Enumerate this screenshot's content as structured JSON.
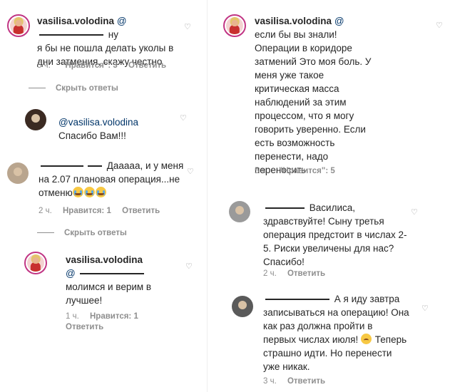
{
  "left": {
    "c1": {
      "username": "vasilisa.volodina",
      "mention": "@",
      "line1_tail": "ну",
      "line2": "я бы не пошла делать уколы в",
      "line3": "дни затмения, скажу честно",
      "time": "5 ч.",
      "likes": "\"Нравится\": 3",
      "reply": "Ответить"
    },
    "hide1": "Скрыть ответы",
    "c2": {
      "line1": "@vasilisa.volodina",
      "line2": "Спасибо Вам!!!"
    },
    "c3": {
      "line1": "Дааааа, и у меня",
      "line2": "на 2.07 плановая операция...не",
      "line3": "отменю",
      "time": "2 ч.",
      "likes": "Нравится: 1",
      "reply": "Ответить"
    },
    "hide2": "Скрыть ответы",
    "c4": {
      "username": "vasilisa.volodina",
      "mention": "@",
      "line2": "молимся и верим в",
      "line3": "лучшее!",
      "time": "1 ч.",
      "likes": "Нравится: 1",
      "reply": "Ответить"
    }
  },
  "right": {
    "c1": {
      "username": "vasilisa.volodina",
      "mention": "@",
      "lines": [
        "если бы вы знали!",
        "Операции в коридоре",
        "затмений Это моя боль. У",
        "меня уже такое",
        "критическая масса",
        "наблюдений за этим",
        "процессом, что я могу",
        "говорить уверенно. Если",
        "есть возможность",
        "перенести, надо",
        "переносить"
      ],
      "time": "5 ч.",
      "likes": "\"Нравится\": 5"
    },
    "c2": {
      "lines": [
        "Василиса,",
        "здравствуйте! Сыну третья",
        "операция предстоит в числах 2-",
        "5. Риски увеличены для нас?",
        "Спасибо!"
      ],
      "time": "2 ч.",
      "reply": "Ответить"
    },
    "c3": {
      "lines": [
        "А я иду завтра",
        "записываться на операцию! Она",
        "как раз должна пройти в",
        "первых числах июля!",
        "Теперь",
        "страшно идти. Но перенести",
        "уже никак."
      ],
      "time": "3 ч.",
      "reply": "Ответить"
    }
  },
  "icons": {
    "heart": "heart-outline-icon",
    "avatar_story": "avatar-story-ring",
    "emoji_cry": "crying-face-emoji",
    "emoji_sad": "sad-face-emoji"
  },
  "colors": {
    "text": "#262626",
    "meta": "#8e8e8e",
    "mention": "#003569",
    "story_ring": "#c13584"
  }
}
